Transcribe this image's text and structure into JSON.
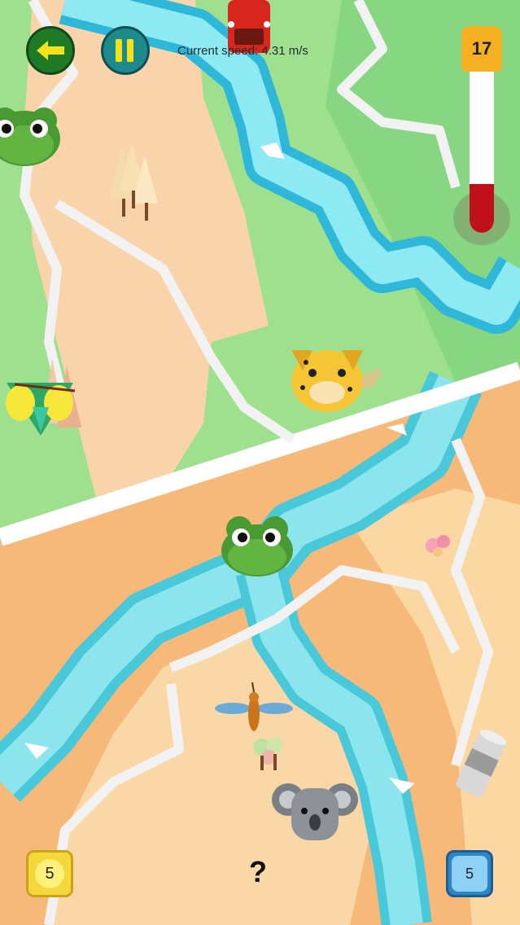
{
  "hud": {
    "speed_text": "Current speed: 4.31 m/s",
    "level": "17",
    "thermometer_fraction": 0.3
  },
  "controls": {
    "back_icon": "arrow-left-icon",
    "pause_icon": "pause-icon",
    "help_label": "?"
  },
  "powerups": {
    "coins": "5",
    "coins_icon": "coin-icon",
    "cracks": "5",
    "cracks_icon": "crack-icon"
  },
  "animals": [
    "frog",
    "leopard",
    "mantis",
    "frog",
    "dragonfly",
    "koala"
  ],
  "items": [
    "car",
    "tin-can"
  ],
  "colors": {
    "grass": "#9fe08f",
    "sand": "#f7c792",
    "river": "#7fe0e8",
    "road": "#f2f2f2",
    "thermometer_red": "#c0101c",
    "level_badge": "#f3b021"
  }
}
